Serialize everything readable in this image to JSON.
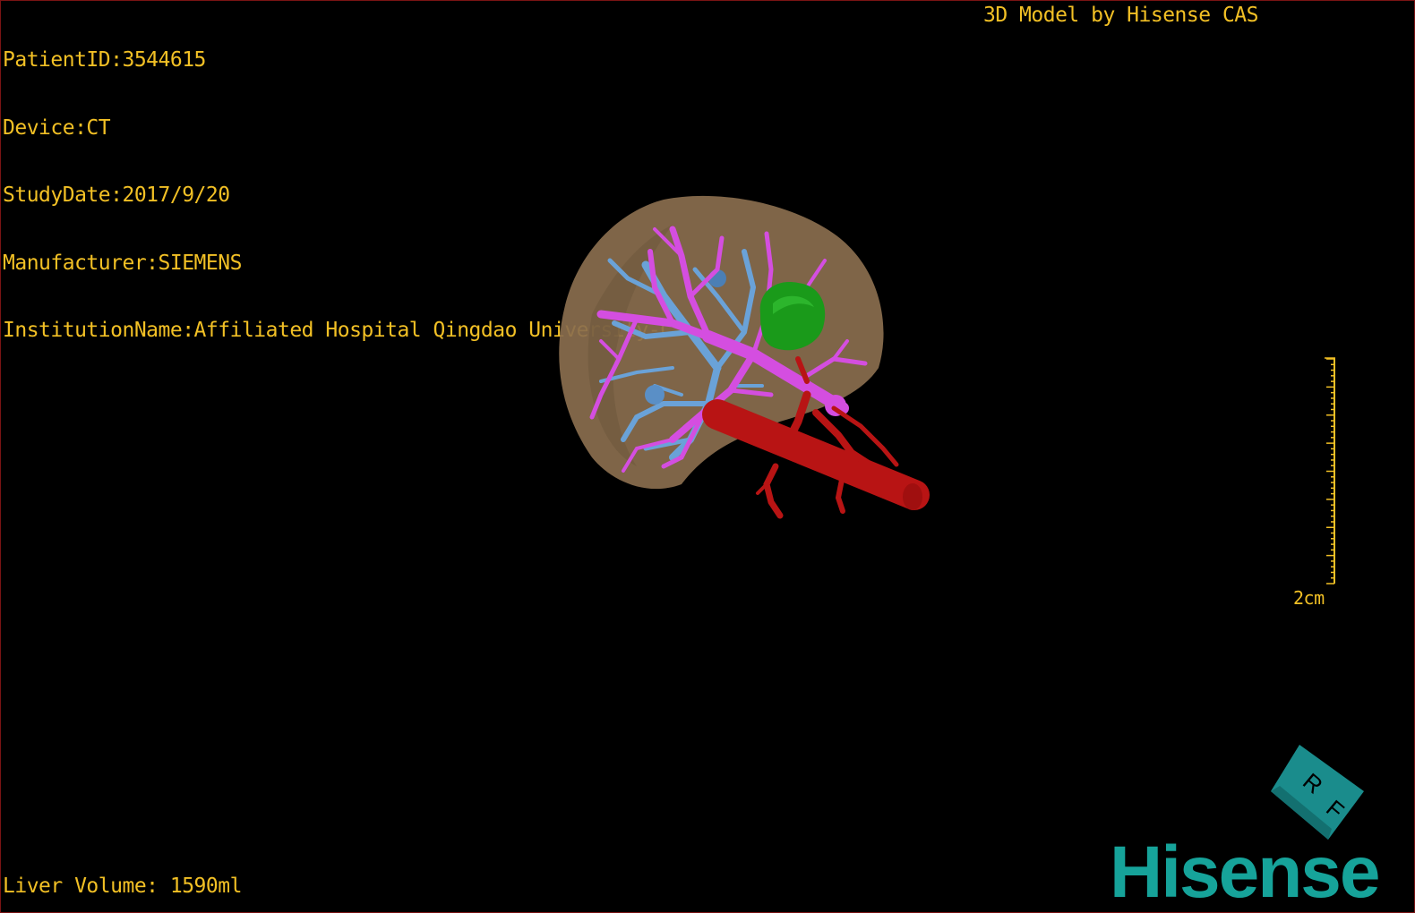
{
  "patient_info": {
    "patient_id": "PatientID:3544615",
    "device": "Device:CT",
    "study_date": "StudyDate:2017/9/20",
    "manufacturer": "Manufacturer:SIEMENS",
    "institution": "InstitutionName:Affiliated Hospital Qingdao University-C"
  },
  "brand_caption": "3D Model by Hisense CAS",
  "liver_volume": "Liver Volume: 1590ml",
  "scale": {
    "label": "2cm"
  },
  "orientation_cube": {
    "face_labels": [
      "R",
      "F"
    ]
  },
  "logo": "Hisense",
  "colors": {
    "overlay_text": "#f2c025",
    "liver": "#8a6e4e",
    "portal_vein": "#d44ee0",
    "hepatic_vein": "#6aa2d8",
    "artery": "#b81414",
    "lesion": "#1a9a1a",
    "cube": "#1a8c8c",
    "logo": "#16a39a"
  }
}
